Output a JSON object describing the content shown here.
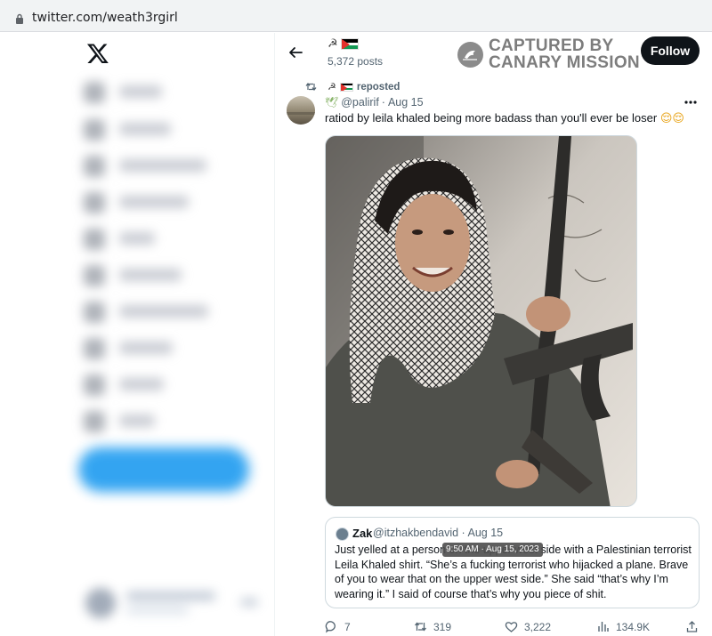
{
  "browser": {
    "url": "twitter.com/weath3rgirl"
  },
  "header": {
    "name_emoji": "☭",
    "post_count": "5,372 posts",
    "watermark_line1": "CAPTURED BY",
    "watermark_line2": "CANARY MISSION",
    "follow_label": "Follow"
  },
  "repost": {
    "emoji": "☭",
    "label": "reposted"
  },
  "tweet": {
    "author_emoji": "🕊",
    "handle": "@palirif",
    "separator": "·",
    "date": "Aug 15",
    "text": "ratiod by leila khaled being more badass than you'll ever be loser",
    "text_emoji": "😌😌"
  },
  "quote": {
    "name": "Zak",
    "handle": "@itzhakbendavid · Aug 15",
    "text": "Just yelled at a person on the upper west side with a Palestinian terrorist Leila Khaled shirt. “She’s a fucking terrorist who hijacked a plane. Brave of you to wear that on the upper west side.” She said “that’s why I’m wearing it.” I said of course that’s why you piece of shit.",
    "tooltip": "9:50 AM · Aug 15, 2023"
  },
  "actions": {
    "replies": "7",
    "reposts": "319",
    "likes": "3,222",
    "views": "134.9K"
  },
  "colors": {
    "follow_bg": "#0f1419",
    "link_blue": "#1d9bf0",
    "muted": "#536471"
  }
}
